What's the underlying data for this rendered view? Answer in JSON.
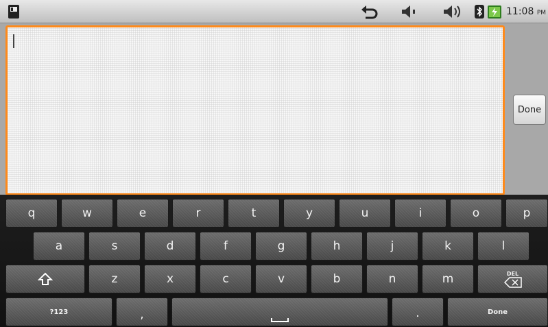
{
  "status_bar": {
    "time": "11:08",
    "ampm": "PM",
    "icons": [
      "sdcard-icon",
      "back-icon",
      "volume-icon",
      "volume-icon",
      "bluetooth-icon",
      "battery-icon"
    ]
  },
  "editor": {
    "text": "",
    "done_label": "Done"
  },
  "keyboard": {
    "row1": [
      "q",
      "w",
      "e",
      "r",
      "t",
      "y",
      "u",
      "i",
      "o",
      "p"
    ],
    "row2": [
      "a",
      "s",
      "d",
      "f",
      "g",
      "h",
      "j",
      "k",
      "l"
    ],
    "row3": [
      "z",
      "x",
      "c",
      "v",
      "b",
      "n",
      "m"
    ],
    "sym_label": "?123",
    "comma": ",",
    "period": ".",
    "done_label": "Done",
    "del_label": "DEL"
  }
}
